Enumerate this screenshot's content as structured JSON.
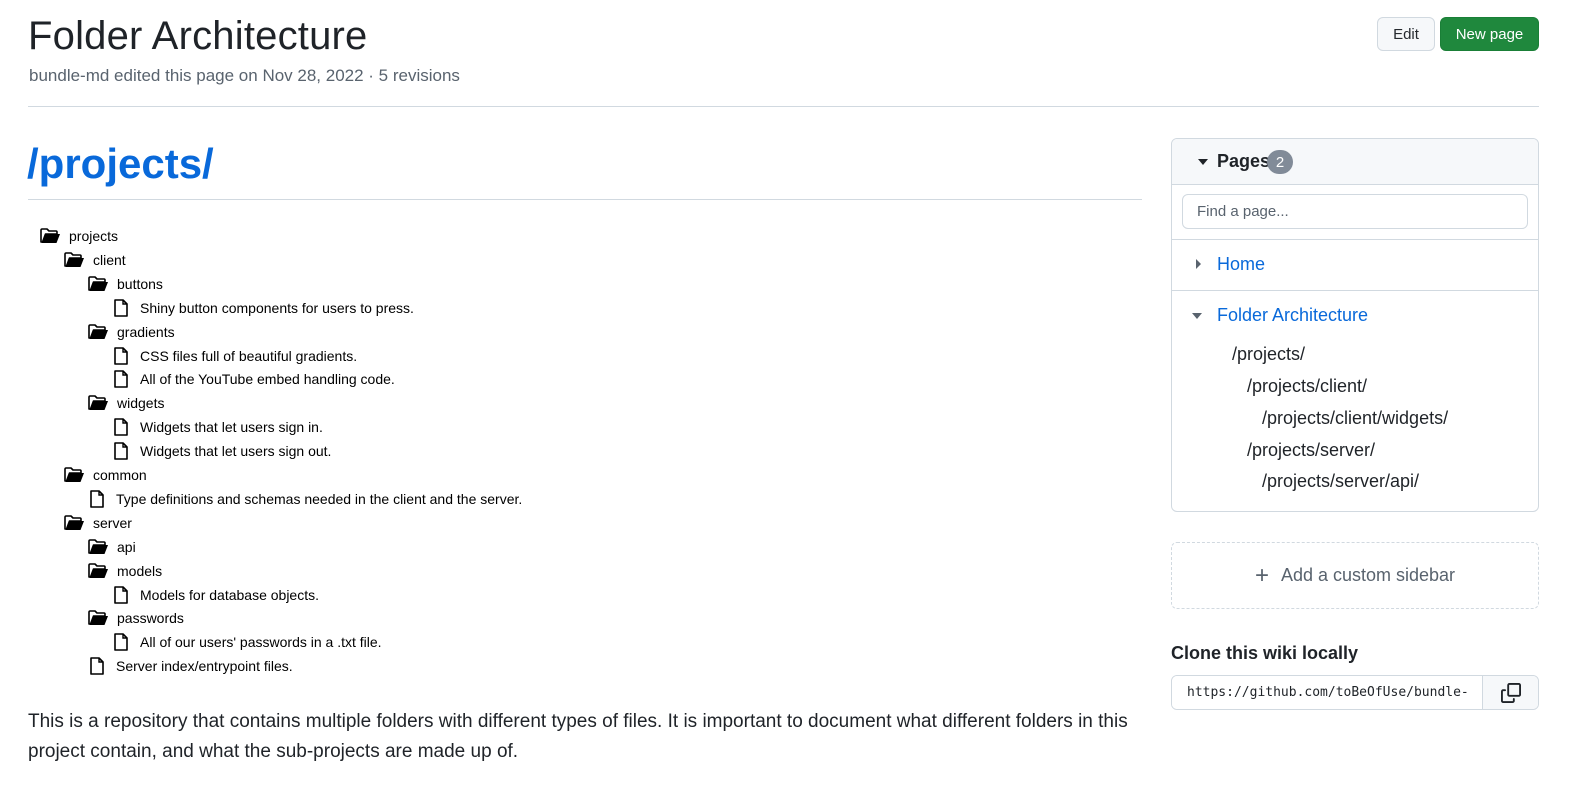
{
  "header": {
    "title": "Folder Architecture",
    "meta": "bundle-md edited this page on Nov 28, 2022 · 5 revisions",
    "edit_label": "Edit",
    "new_page_label": "New page"
  },
  "content": {
    "heading": "/projects/",
    "tree": [
      {
        "type": "folder",
        "depth": 0,
        "label": "projects"
      },
      {
        "type": "folder",
        "depth": 1,
        "label": "client"
      },
      {
        "type": "folder",
        "depth": 2,
        "label": "buttons"
      },
      {
        "type": "file",
        "depth": 3,
        "label": "Shiny button components for users to press."
      },
      {
        "type": "folder",
        "depth": 2,
        "label": "gradients"
      },
      {
        "type": "file",
        "depth": 3,
        "label": "CSS files full of beautiful gradients."
      },
      {
        "type": "file",
        "depth": 3,
        "label": "All of the YouTube embed handling code."
      },
      {
        "type": "folder",
        "depth": 2,
        "label": "widgets"
      },
      {
        "type": "file",
        "depth": 3,
        "label": "Widgets that let users sign in."
      },
      {
        "type": "file",
        "depth": 3,
        "label": "Widgets that let users sign out."
      },
      {
        "type": "folder",
        "depth": 1,
        "label": "common"
      },
      {
        "type": "file",
        "depth": 2,
        "label": "Type definitions and schemas needed in the client and the server."
      },
      {
        "type": "folder",
        "depth": 1,
        "label": "server"
      },
      {
        "type": "folder",
        "depth": 2,
        "label": "api"
      },
      {
        "type": "folder",
        "depth": 2,
        "label": "models"
      },
      {
        "type": "file",
        "depth": 3,
        "label": "Models for database objects."
      },
      {
        "type": "folder",
        "depth": 2,
        "label": "passwords"
      },
      {
        "type": "file",
        "depth": 3,
        "label": "All of our users' passwords in a .txt file."
      },
      {
        "type": "file",
        "depth": 2,
        "label": "Server index/entrypoint files."
      }
    ],
    "description": "This is a repository that contains multiple folders with different types of files. It is important to document what different folders in this project contain, and what the sub-projects are made up of."
  },
  "sidebar": {
    "pages_label": "Pages",
    "pages_count": "2",
    "search_placeholder": "Find a page...",
    "pages": [
      {
        "label": "Home",
        "expanded": false
      },
      {
        "label": "Folder Architecture",
        "expanded": true
      }
    ],
    "subheadings": [
      {
        "label": "/projects/",
        "level": 1
      },
      {
        "label": "/projects/client/",
        "level": 2
      },
      {
        "label": "/projects/client/widgets/",
        "level": 3
      },
      {
        "label": "/projects/server/",
        "level": 2
      },
      {
        "label": "/projects/server/api/",
        "level": 3
      }
    ],
    "add_custom_sidebar": "Add a custom sidebar",
    "clone_title": "Clone this wiki locally",
    "clone_url": "https://github.com/toBeOfUse/bundle-md.wiki.git"
  },
  "colors": {
    "link": "#0969da",
    "primary_button": "#1f883d",
    "border": "#d1d9e0",
    "muted_text": "#59636e"
  },
  "icons": {
    "folder": "folder-open-icon",
    "file": "file-icon",
    "copy": "copy-icon",
    "plus": "plus-icon"
  }
}
